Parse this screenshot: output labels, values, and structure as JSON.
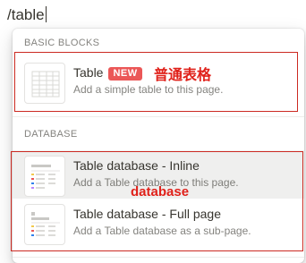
{
  "command": {
    "text": "/table"
  },
  "menu": {
    "sections": [
      {
        "label": "BASIC BLOCKS",
        "items": [
          {
            "title": "Table",
            "badge": "NEW",
            "description": "Add a simple table to this page."
          }
        ]
      },
      {
        "label": "DATABASE",
        "items": [
          {
            "title": "Table database - Inline",
            "description": "Add a Table database to this page."
          },
          {
            "title": "Table database - Full page",
            "description": "Add a Table database as a sub-page."
          }
        ]
      }
    ]
  },
  "annotations": {
    "basic_table_note": "普通表格",
    "database_note": "database",
    "color": "#e0211a"
  },
  "colors": {
    "badge": "#eb5757",
    "hover_background": "#efefee"
  }
}
